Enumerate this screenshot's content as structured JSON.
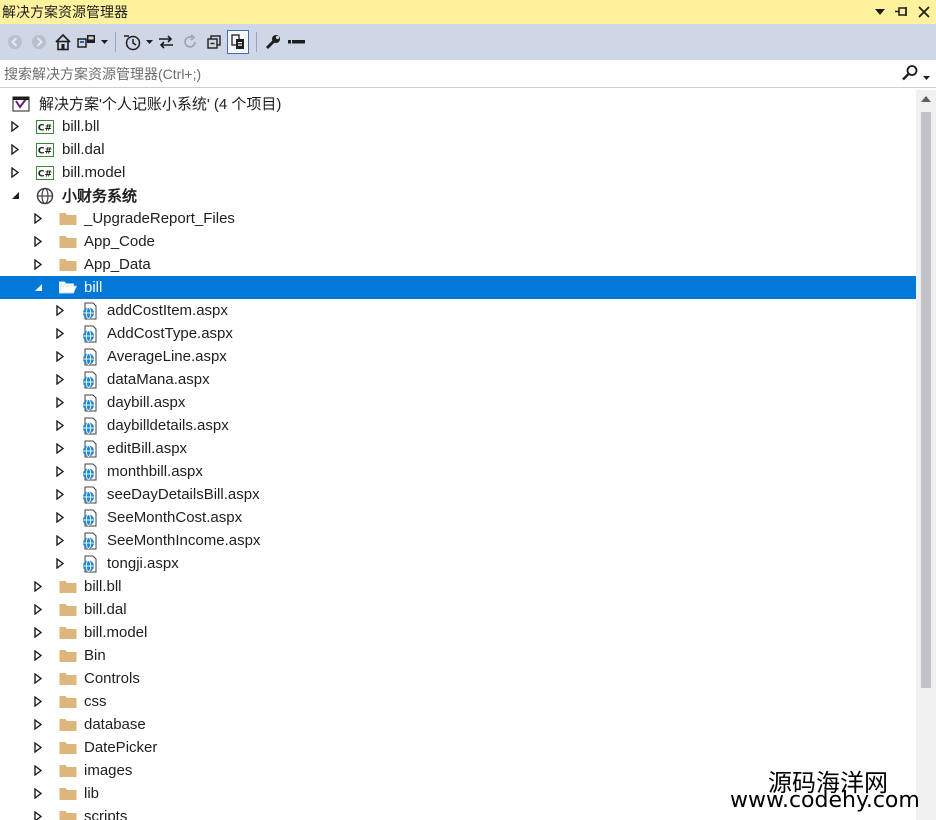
{
  "window": {
    "title": "解决方案资源管理器",
    "controls": [
      "dropdown-icon",
      "pin-icon",
      "close-icon"
    ]
  },
  "toolbar": {
    "buttons": [
      {
        "name": "back-icon"
      },
      {
        "name": "forward-icon"
      },
      {
        "name": "home-icon"
      },
      {
        "name": "switch-views-icon"
      },
      {
        "name": "pending-changes-icon"
      },
      {
        "name": "sync-active-icon"
      },
      {
        "name": "refresh-icon"
      },
      {
        "name": "collapse-all-icon"
      },
      {
        "name": "show-all-files-icon"
      },
      {
        "name": "properties-icon"
      },
      {
        "name": "preview-icon"
      }
    ]
  },
  "search": {
    "placeholder": "搜索解决方案资源管理器(Ctrl+;)"
  },
  "tree": {
    "solution": "解决方案'个人记账小系统' (4 个项目)",
    "items": [
      {
        "label": "bill.bll",
        "icon": "csharp-project-icon",
        "level": 0,
        "expanded": false
      },
      {
        "label": "bill.dal",
        "icon": "csharp-project-icon",
        "level": 0,
        "expanded": false
      },
      {
        "label": "bill.model",
        "icon": "csharp-project-icon",
        "level": 0,
        "expanded": false
      },
      {
        "label": "小财务系统",
        "icon": "website-globe-icon",
        "level": 0,
        "expanded": true,
        "bold": true
      },
      {
        "label": "_UpgradeReport_Files",
        "icon": "folder-icon",
        "level": 1,
        "expanded": false
      },
      {
        "label": "App_Code",
        "icon": "folder-icon",
        "level": 1,
        "expanded": false
      },
      {
        "label": "App_Data",
        "icon": "folder-icon",
        "level": 1,
        "expanded": false
      },
      {
        "label": "bill",
        "icon": "folder-open-icon",
        "level": 1,
        "expanded": true,
        "selected": true
      },
      {
        "label": "addCostItem.aspx",
        "icon": "aspx-file-icon",
        "level": 2,
        "expanded": false
      },
      {
        "label": "AddCostType.aspx",
        "icon": "aspx-file-icon",
        "level": 2,
        "expanded": false
      },
      {
        "label": "AverageLine.aspx",
        "icon": "aspx-file-icon",
        "level": 2,
        "expanded": false
      },
      {
        "label": "dataMana.aspx",
        "icon": "aspx-file-icon",
        "level": 2,
        "expanded": false
      },
      {
        "label": "daybill.aspx",
        "icon": "aspx-file-icon",
        "level": 2,
        "expanded": false
      },
      {
        "label": "daybilldetails.aspx",
        "icon": "aspx-file-icon",
        "level": 2,
        "expanded": false
      },
      {
        "label": "editBill.aspx",
        "icon": "aspx-file-icon",
        "level": 2,
        "expanded": false
      },
      {
        "label": "monthbill.aspx",
        "icon": "aspx-file-icon",
        "level": 2,
        "expanded": false
      },
      {
        "label": "seeDayDetailsBill.aspx",
        "icon": "aspx-file-icon",
        "level": 2,
        "expanded": false
      },
      {
        "label": "SeeMonthCost.aspx",
        "icon": "aspx-file-icon",
        "level": 2,
        "expanded": false
      },
      {
        "label": "SeeMonthIncome.aspx",
        "icon": "aspx-file-icon",
        "level": 2,
        "expanded": false
      },
      {
        "label": "tongji.aspx",
        "icon": "aspx-file-icon",
        "level": 2,
        "expanded": false
      },
      {
        "label": "bill.bll",
        "icon": "folder-icon",
        "level": 1,
        "expanded": false
      },
      {
        "label": "bill.dal",
        "icon": "folder-icon",
        "level": 1,
        "expanded": false
      },
      {
        "label": "bill.model",
        "icon": "folder-icon",
        "level": 1,
        "expanded": false
      },
      {
        "label": "Bin",
        "icon": "folder-icon",
        "level": 1,
        "expanded": false
      },
      {
        "label": "Controls",
        "icon": "folder-icon",
        "level": 1,
        "expanded": false
      },
      {
        "label": "css",
        "icon": "folder-icon",
        "level": 1,
        "expanded": false
      },
      {
        "label": "database",
        "icon": "folder-icon",
        "level": 1,
        "expanded": false
      },
      {
        "label": "DatePicker",
        "icon": "folder-icon",
        "level": 1,
        "expanded": false
      },
      {
        "label": "images",
        "icon": "folder-icon",
        "level": 1,
        "expanded": false
      },
      {
        "label": "lib",
        "icon": "folder-icon",
        "level": 1,
        "expanded": false
      },
      {
        "label": "scripts",
        "icon": "folder-icon",
        "level": 1,
        "expanded": false
      }
    ]
  },
  "watermark": {
    "line1": "源码海洋网",
    "line2": "www.codehy.com"
  },
  "colors": {
    "titlebar": "#fff29d",
    "toolbar": "#cfd6e5",
    "selection": "#0078d7",
    "folder": "#dcb67a"
  }
}
